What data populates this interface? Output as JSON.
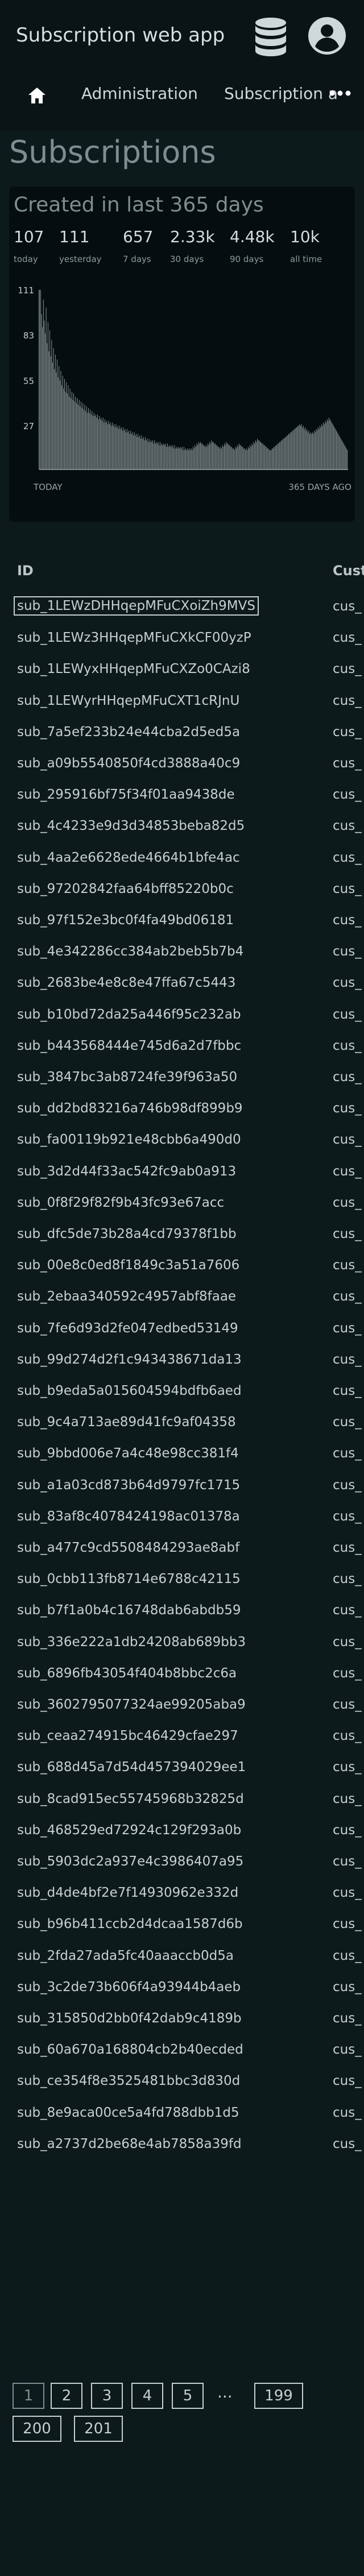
{
  "header": {
    "app_title": "Subscription web app",
    "icons": [
      "database-icon",
      "user-account-icon"
    ]
  },
  "nav": {
    "home_icon": "home-icon",
    "items": [
      "Administration",
      "Subscription a"
    ],
    "more_icon": "more-horizontal-icon"
  },
  "page": {
    "title": "Subscriptions"
  },
  "stats": {
    "title": "Created in last 365 days",
    "items": [
      {
        "value": "107",
        "label": "today"
      },
      {
        "value": "111",
        "label": "yesterday"
      },
      {
        "value": "657",
        "label": "7 days"
      },
      {
        "value": "2.33k",
        "label": "30 days"
      },
      {
        "value": "4.48k",
        "label": "90 days"
      },
      {
        "value": "10k",
        "label": "all time"
      }
    ]
  },
  "chart_data": {
    "type": "bar",
    "y_ticks": [
      111,
      83,
      55,
      27
    ],
    "ylim": [
      0,
      111
    ],
    "x_labels": [
      "TODAY",
      "365 DAYS AGO"
    ],
    "grid": false,
    "values": [
      111,
      96,
      88,
      105,
      92,
      84,
      100,
      78,
      91,
      73,
      86,
      70,
      80,
      66,
      75,
      62,
      71,
      60,
      68,
      57,
      64,
      55,
      61,
      52,
      58,
      50,
      56,
      48,
      54,
      47,
      52,
      45,
      50,
      44,
      48,
      43,
      47,
      42,
      45,
      41,
      44,
      40,
      43,
      39,
      42,
      38,
      41,
      37,
      40,
      36,
      39,
      35,
      38,
      35,
      37,
      34,
      36,
      33,
      35,
      33,
      34,
      32,
      34,
      31,
      33,
      31,
      32,
      30,
      32,
      29,
      31,
      29,
      30,
      28,
      30,
      28,
      29,
      27,
      29,
      27,
      28,
      26,
      28,
      26,
      27,
      25,
      27,
      25,
      26,
      24,
      26,
      24,
      25,
      23,
      25,
      23,
      24,
      22,
      24,
      22,
      23,
      21,
      23,
      21,
      22,
      20,
      22,
      20,
      21,
      19,
      21,
      19,
      20,
      18,
      20,
      18,
      19,
      17,
      19,
      17,
      18,
      17,
      18,
      16,
      18,
      16,
      17,
      16,
      17,
      15,
      17,
      15,
      16,
      15,
      16,
      15,
      16,
      14,
      16,
      14,
      15,
      14,
      15,
      14,
      15,
      13,
      15,
      13,
      14,
      13,
      14,
      13,
      14,
      13,
      14,
      12,
      14,
      12,
      13,
      12,
      13,
      12,
      13,
      12,
      13,
      12,
      14,
      13,
      15,
      14,
      16,
      15,
      17,
      16,
      17,
      16,
      16,
      15,
      15,
      14,
      15,
      14,
      16,
      15,
      17,
      16,
      18,
      17,
      17,
      16,
      16,
      15,
      15,
      14,
      14,
      13,
      14,
      13,
      15,
      14,
      16,
      15,
      17,
      16,
      16,
      15,
      15,
      14,
      14,
      13,
      13,
      12,
      14,
      13,
      15,
      14,
      16,
      15,
      15,
      14,
      14,
      13,
      13,
      12,
      13,
      12,
      14,
      13,
      15,
      14,
      16,
      15,
      17,
      16,
      18,
      17,
      19,
      18,
      18,
      17,
      17,
      16,
      16,
      15,
      15,
      14,
      14,
      13,
      13,
      12,
      12,
      12,
      13,
      13,
      14,
      14,
      15,
      15,
      16,
      16,
      17,
      17,
      18,
      18,
      19,
      19,
      20,
      20,
      21,
      21,
      22,
      22,
      23,
      23,
      24,
      24,
      25,
      25,
      26,
      26,
      27,
      27,
      28,
      27,
      28,
      26,
      27,
      25,
      26,
      24,
      25,
      23,
      24,
      22,
      23,
      22,
      23,
      22,
      24,
      23,
      25,
      24,
      26,
      25,
      27,
      26,
      28,
      27,
      29,
      28,
      30,
      29,
      31,
      30,
      32,
      31,
      30,
      29,
      28,
      27,
      26,
      25,
      24,
      23,
      22,
      21,
      20,
      19,
      18,
      17,
      16,
      15,
      14,
      13,
      12
    ]
  },
  "table": {
    "columns": [
      "ID",
      "Customer"
    ],
    "rows": [
      {
        "id": "sub_1LEWzDHHqepMFuCXoiZh9MVS",
        "customer": "cus_"
      },
      {
        "id": "sub_1LEWz3HHqepMFuCXkCF00yzP",
        "customer": "cus_"
      },
      {
        "id": "sub_1LEWyxHHqepMFuCXZo0CAzi8",
        "customer": "cus_"
      },
      {
        "id": "sub_1LEWyrHHqepMFuCXT1cRJnU",
        "customer": "cus_"
      },
      {
        "id": "sub_7a5ef233b24e44cba2d5ed5a",
        "customer": "cus_"
      },
      {
        "id": "sub_a09b5540850f4cd3888a40c9",
        "customer": "cus_"
      },
      {
        "id": "sub_295916bf75f34f01aa9438de",
        "customer": "cus_"
      },
      {
        "id": "sub_4c4233e9d3d34853beba82d5",
        "customer": "cus_"
      },
      {
        "id": "sub_4aa2e6628ede4664b1bfe4ac",
        "customer": "cus_"
      },
      {
        "id": "sub_97202842faa64bff85220b0c",
        "customer": "cus_"
      },
      {
        "id": "sub_97f152e3bc0f4fa49bd06181",
        "customer": "cus_"
      },
      {
        "id": "sub_4e342286cc384ab2beb5b7b4",
        "customer": "cus_"
      },
      {
        "id": "sub_2683be4e8c8e47ffa67c5443",
        "customer": "cus_"
      },
      {
        "id": "sub_b10bd72da25a446f95c232ab",
        "customer": "cus_"
      },
      {
        "id": "sub_b443568444e745d6a2d7fbbc",
        "customer": "cus_"
      },
      {
        "id": "sub_3847bc3ab8724fe39f963a50",
        "customer": "cus_"
      },
      {
        "id": "sub_dd2bd83216a746b98df899b9",
        "customer": "cus_"
      },
      {
        "id": "sub_fa00119b921e48cbb6a490d0",
        "customer": "cus_"
      },
      {
        "id": "sub_3d2d44f33ac542fc9ab0a913",
        "customer": "cus_"
      },
      {
        "id": "sub_0f8f29f82f9b43fc93e67acc",
        "customer": "cus_"
      },
      {
        "id": "sub_dfc5de73b28a4cd79378f1bb",
        "customer": "cus_"
      },
      {
        "id": "sub_00e8c0ed8f1849c3a51a7606",
        "customer": "cus_"
      },
      {
        "id": "sub_2ebaa340592c4957abf8faae",
        "customer": "cus_"
      },
      {
        "id": "sub_7fe6d93d2fe047edbed53149",
        "customer": "cus_"
      },
      {
        "id": "sub_99d274d2f1c943438671da13",
        "customer": "cus_"
      },
      {
        "id": "sub_b9eda5a015604594bdfb6aed",
        "customer": "cus_"
      },
      {
        "id": "sub_9c4a713ae89d41fc9af04358",
        "customer": "cus_"
      },
      {
        "id": "sub_9bbd006e7a4c48e98cc381f4",
        "customer": "cus_"
      },
      {
        "id": "sub_a1a03cd873b64d9797fc1715",
        "customer": "cus_"
      },
      {
        "id": "sub_83af8c4078424198ac01378a",
        "customer": "cus_"
      },
      {
        "id": "sub_a477c9cd5508484293ae8abf",
        "customer": "cus_"
      },
      {
        "id": "sub_0cbb113fb8714e6788c42115",
        "customer": "cus_"
      },
      {
        "id": "sub_b7f1a0b4c16748dab6abdb59",
        "customer": "cus_"
      },
      {
        "id": "sub_336e222a1db24208ab689bb3",
        "customer": "cus_"
      },
      {
        "id": "sub_6896fb43054f404b8bbc2c6a",
        "customer": "cus_"
      },
      {
        "id": "sub_3602795077324ae99205aba9",
        "customer": "cus_"
      },
      {
        "id": "sub_ceaa274915bc46429cfae297",
        "customer": "cus_"
      },
      {
        "id": "sub_688d45a7d54d457394029ee1",
        "customer": "cus_"
      },
      {
        "id": "sub_8cad915ec55745968b32825d",
        "customer": "cus_"
      },
      {
        "id": "sub_468529ed72924c129f293a0b",
        "customer": "cus_"
      },
      {
        "id": "sub_5903dc2a937e4c3986407a95",
        "customer": "cus_"
      },
      {
        "id": "sub_d4de4bf2e7f14930962e332d",
        "customer": "cus_"
      },
      {
        "id": "sub_b96b411ccb2d4dcaa1587d6b",
        "customer": "cus_"
      },
      {
        "id": "sub_2fda27ada5fc40aaaccb0d5a",
        "customer": "cus_"
      },
      {
        "id": "sub_3c2de73b606f4a93944b4aeb",
        "customer": "cus_"
      },
      {
        "id": "sub_315850d2bb0f42dab9c4189b",
        "customer": "cus_"
      },
      {
        "id": "sub_60a670a168804cb2b40ecded",
        "customer": "cus_"
      },
      {
        "id": "sub_ce354f8e3525481bbc3d830d",
        "customer": "cus_"
      },
      {
        "id": "sub_8e9aca00ce5a4fd788dbb1d5",
        "customer": "cus_"
      },
      {
        "id": "sub_a2737d2be68e4ab7858a39fd",
        "customer": "cus_"
      }
    ]
  },
  "pagination": {
    "pages": [
      "1",
      "2",
      "3",
      "4",
      "5"
    ],
    "ellipsis": "...",
    "last_pages": [
      "199",
      "200",
      "201"
    ],
    "current": "1"
  },
  "colors": {
    "background": "#0c1a1c",
    "header": "#0a1416",
    "panel": "#050d0f",
    "text": "#c6d0d1",
    "muted": "#7f8d90",
    "bars": "#9aa4a6"
  }
}
